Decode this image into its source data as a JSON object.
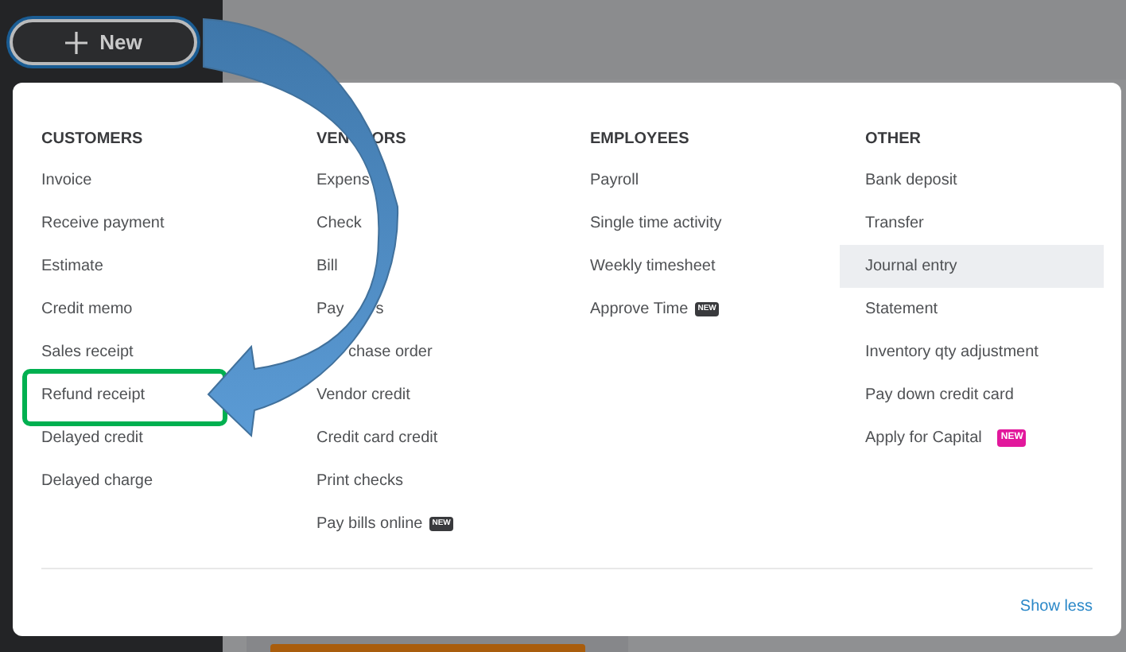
{
  "new_button": {
    "label": "New"
  },
  "columns": [
    {
      "heading": [
        "CUSTOMERS"
      ],
      "items": [
        {
          "label": [
            "Invoice"
          ],
          "selected": false
        },
        {
          "label": [
            "Receive payment"
          ],
          "selected": false
        },
        {
          "label": [
            "Estimate"
          ],
          "selected": false
        },
        {
          "label": [
            "Credit memo"
          ],
          "selected": false
        },
        {
          "label": [
            "Sales receipt"
          ],
          "selected": false
        },
        {
          "label": [
            "Refund receipt"
          ],
          "selected": false
        },
        {
          "label": [
            "Delayed credit"
          ],
          "selected": false
        },
        {
          "label": [
            "Delayed charge"
          ],
          "selected": false
        }
      ]
    },
    {
      "heading": [
        "VEN",
        "ORS"
      ],
      "items": [
        {
          "label": [
            "Expens"
          ],
          "selected": false
        },
        {
          "label": [
            "Check"
          ],
          "selected": false
        },
        {
          "label": [
            "Bill"
          ],
          "selected": false
        },
        {
          "label": [
            "Pay",
            "s"
          ],
          "selected": false
        },
        {
          "label": [
            "chase order"
          ],
          "selected": false,
          "kind": "indented"
        },
        {
          "label": [
            "Vendor credit"
          ],
          "selected": false
        },
        {
          "label": [
            "Credit card credit"
          ],
          "selected": false
        },
        {
          "label": [
            "Print checks"
          ],
          "selected": false
        },
        {
          "label": [
            "Pay bills online"
          ],
          "selected": false,
          "badge": {
            "text": "NEW",
            "color": "#393a3d"
          }
        }
      ]
    },
    {
      "heading": [
        "EMPLOYEES"
      ],
      "items": [
        {
          "label": [
            "Payroll"
          ],
          "selected": false
        },
        {
          "label": [
            "Single time activity"
          ],
          "selected": false
        },
        {
          "label": [
            "Weekly timesheet"
          ],
          "selected": false
        },
        {
          "label": [
            "Approve Time"
          ],
          "selected": false,
          "badge": {
            "text": "NEW",
            "color": "#393a3d"
          }
        }
      ]
    },
    {
      "heading": [
        "OTHER"
      ],
      "items": [
        {
          "label": [
            "Bank deposit"
          ],
          "selected": false
        },
        {
          "label": [
            "Transfer"
          ],
          "selected": false
        },
        {
          "label": [
            "Journal entry"
          ],
          "selected": true
        },
        {
          "label": [
            "Statement"
          ],
          "selected": false
        },
        {
          "label": [
            "Inventory qty adjustment"
          ],
          "selected": false
        },
        {
          "label": [
            "Pay down credit card"
          ],
          "selected": false
        },
        {
          "label": [
            "Apply for Capital"
          ],
          "selected": false,
          "badge": {
            "text": "NEW",
            "color": "#e2189c"
          }
        }
      ]
    }
  ],
  "footer_link": "Show less"
}
